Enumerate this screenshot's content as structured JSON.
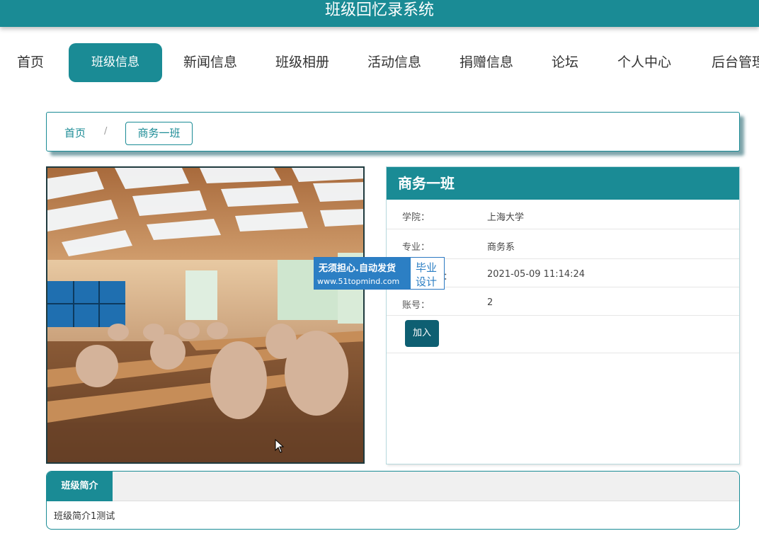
{
  "header": {
    "title": "班级回忆录系统"
  },
  "nav": {
    "items": [
      {
        "label": "首页"
      },
      {
        "label": "班级信息"
      },
      {
        "label": "新闻信息"
      },
      {
        "label": "班级相册"
      },
      {
        "label": "活动信息"
      },
      {
        "label": "捐赠信息"
      },
      {
        "label": "论坛"
      },
      {
        "label": "个人中心"
      },
      {
        "label": "后台管理"
      }
    ],
    "active": "班级信息"
  },
  "breadcrumb": {
    "home": "首页",
    "separator": "/",
    "current": "商务一班"
  },
  "detail": {
    "title": "商务一班",
    "fields": [
      {
        "label": "学院：",
        "value": "上海大学"
      },
      {
        "label": "专业：",
        "value": "商务系"
      },
      {
        "label": "：",
        "value": "2021-05-09 11:14:24"
      },
      {
        "label": "账号：",
        "value": "2"
      }
    ],
    "join_label": "加入"
  },
  "watermark": {
    "line1": "无须担心.自动发货",
    "line2": "www.51topmind.com",
    "tag1": "毕业",
    "tag2": "设计"
  },
  "intro": {
    "tab_label": "班级简介",
    "text": "班级简介1测试"
  },
  "colors": {
    "primary": "#1a8b95",
    "button": "#0e5f72",
    "watermark": "#2c7fc4"
  }
}
